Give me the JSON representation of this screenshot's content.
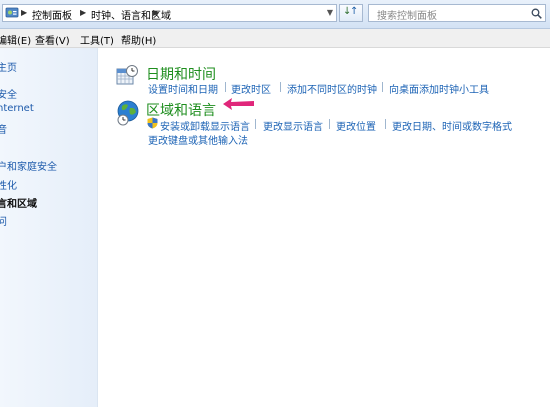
{
  "address_bar": {
    "crumbs": [
      "控制面板",
      "时钟、语言和区域"
    ],
    "search_placeholder": "搜索控制面板"
  },
  "menu": {
    "items": [
      "编辑(E)",
      "查看(V)",
      "工具(T)",
      "帮助(H)"
    ]
  },
  "sidebar": {
    "items": [
      {
        "label": "主页"
      },
      {
        "label": "安全"
      },
      {
        "label": "nternet"
      },
      {
        "label": "音"
      },
      {
        "label": "户和家庭安全"
      },
      {
        "label": "性化"
      },
      {
        "label": "言和区域"
      },
      {
        "label": "问"
      }
    ]
  },
  "categories": [
    {
      "title": "日期和时间",
      "icon": "calendar-clock-icon",
      "tasks": [
        "设置时间和日期",
        "更改时区",
        "添加不同时区的时钟",
        "向桌面添加时钟小工具"
      ]
    },
    {
      "title": "区域和语言",
      "icon": "globe-clock-icon",
      "tasks": [
        "安装或卸载显示语言",
        "更改显示语言",
        "更改位置",
        "更改日期、时间或数字格式",
        "更改键盘或其他输入法"
      ]
    }
  ],
  "colors": {
    "category_title": "#1e8e1e",
    "link": "#1c63b5",
    "arrow": "#e0267a"
  }
}
